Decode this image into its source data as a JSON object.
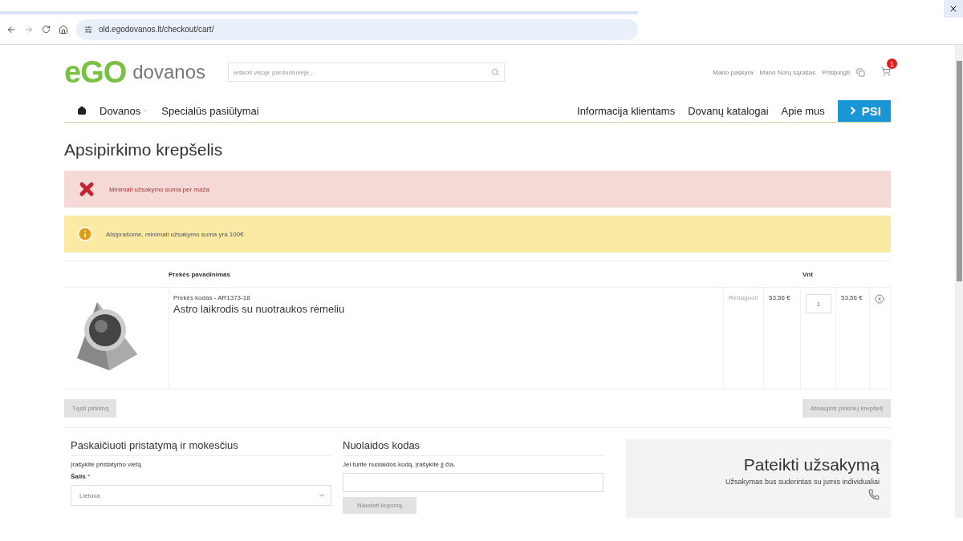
{
  "browser": {
    "url": "old.egodovanos.lt/checkout/cart/"
  },
  "header": {
    "logo_mark": "eGO",
    "logo_text": "dovanos",
    "search": {
      "placeholder": "Ieškoti visoje parduotuvėje..."
    },
    "links": [
      "Mano paskyra",
      "Mano Norų sąrašas",
      "Prisijungti"
    ],
    "cart_count": "1"
  },
  "nav": {
    "left": [
      {
        "label": "Dovanos",
        "dropdown": true
      },
      {
        "label": "Specialūs pasiūlymai",
        "dropdown": false
      }
    ],
    "right": [
      "Informacija klientams",
      "Dovanų katalogai",
      "Apie mus"
    ],
    "badge": "PSI"
  },
  "title": "Apsipirkimo krepšelis",
  "messages": [
    {
      "kind": "error",
      "text": "Minimali užsakymo suma per maža"
    },
    {
      "kind": "notice",
      "text": "Atsiprašome, minimali užsakymo suma yra 100€"
    }
  ],
  "table": {
    "columns": [
      "Prekės pavadinimas",
      "Vnt"
    ],
    "rows": [
      {
        "sku": "Prekės kodas - AR1373-18",
        "name": "Astro laikrodis su nuotraukos rėmeliu",
        "edit": "Redaguoti",
        "price": "53,56 €",
        "qty": "1",
        "subtotal": "53,56 €"
      }
    ]
  },
  "actions": {
    "continue": "Tęsti pirkimą",
    "update": "Atnaujinti pirkinių krepšelį"
  },
  "shipping": {
    "title": "Paskaičiuoti pristatymą ir mokesčius",
    "hint": "Įrašykite pristatymo vietą",
    "country_label": "Šalis",
    "required": "*",
    "country": "Lietuva"
  },
  "discount": {
    "title": "Nuolaidos kodas",
    "hint": "Jei turite nuolaidos kodą, įrašykite jį čia.",
    "button": "Naudoti kuponą"
  },
  "submit": {
    "title": "Pateikti užsakymą",
    "text": "Užsakymas bus suderintas su jumis individualiai"
  }
}
